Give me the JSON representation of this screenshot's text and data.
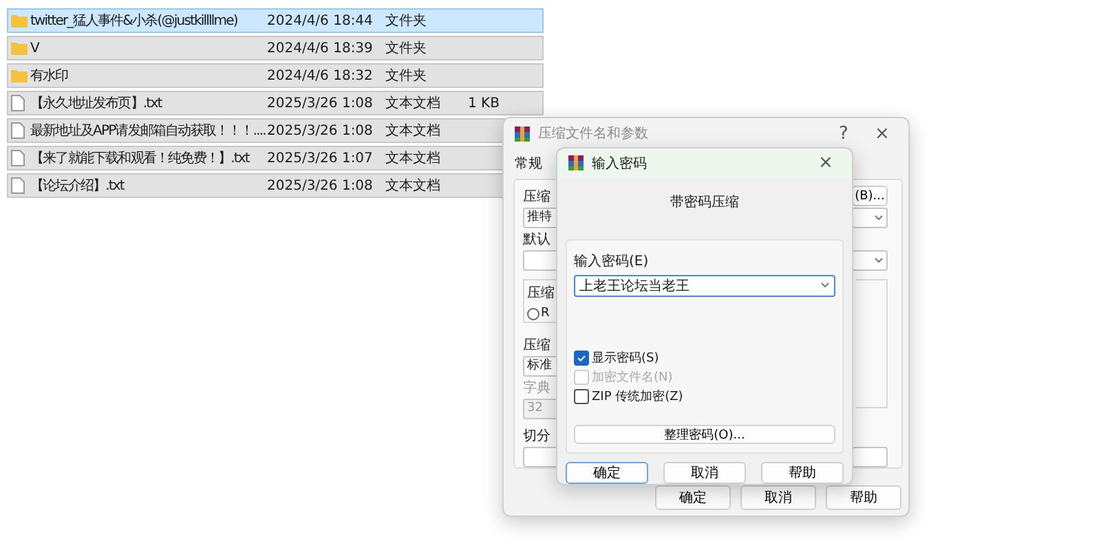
{
  "files": [
    {
      "kind": "folder",
      "name": "twitter_猛人事件&小杀(@justkillllme)",
      "date": "2024/4/6 18:44",
      "type": "文件夹",
      "selected": true,
      "focused": true
    },
    {
      "kind": "folder",
      "name": "V",
      "date": "2024/4/6 18:39",
      "type": "文件夹",
      "selected": true,
      "focused": false
    },
    {
      "kind": "folder",
      "name": "有水印",
      "date": "2024/4/6 18:32",
      "type": "文件夹",
      "selected": true,
      "focused": false
    },
    {
      "kind": "text",
      "name": "【永久地址发布页】.txt",
      "date": "2025/3/26 1:08",
      "type": "文本文档",
      "size": "1 KB",
      "selected": true,
      "focused": false
    },
    {
      "kind": "text",
      "name": "最新地址及APP请发邮箱自动获取！！！....",
      "date": "2025/3/26 1:08",
      "type": "文本文档",
      "selected": true,
      "focused": false
    },
    {
      "kind": "text",
      "name": "【来了就能下载和观看！纯免费！】.txt",
      "date": "2025/3/26 1:07",
      "type": "文本文档",
      "selected": true,
      "focused": false
    },
    {
      "kind": "text",
      "name": "【论坛介绍】.txt",
      "date": "2025/3/26 1:08",
      "type": "文本文档",
      "selected": true,
      "focused": false
    }
  ],
  "back_dialog": {
    "title": "压缩文件名和参数",
    "help": "?",
    "close": "×",
    "tab": "常规",
    "archive_label": "压缩",
    "browse_button": "(B)...",
    "archive_value": "推特",
    "profile_label": "默认",
    "group_label": "压缩",
    "radio": {
      "label": "R",
      "selected": false
    },
    "method_label": "压缩",
    "method_value": "标准",
    "dictionary": {
      "label": "字典",
      "value": "32",
      "disabled": true
    },
    "split_label": "切分",
    "buttons": [
      "确定",
      "取消",
      "帮助"
    ]
  },
  "password_dialog": {
    "title": "输入密码",
    "close": "×",
    "heading": "带密码压缩",
    "password_label": "输入密码(E)",
    "password_value": "上老王论坛当老王",
    "checkboxes": [
      {
        "label": "显示密码(S)",
        "checked": true,
        "disabled": false
      },
      {
        "label": "加密文件名(N)",
        "checked": false,
        "disabled": true
      },
      {
        "label": "ZIP 传统加密(Z)",
        "checked": false,
        "disabled": false
      }
    ],
    "organize_button": "整理密码(O)...",
    "buttons": [
      {
        "label": "确定",
        "default": true
      },
      {
        "label": "取消",
        "default": false
      },
      {
        "label": "帮助",
        "default": false
      }
    ]
  }
}
